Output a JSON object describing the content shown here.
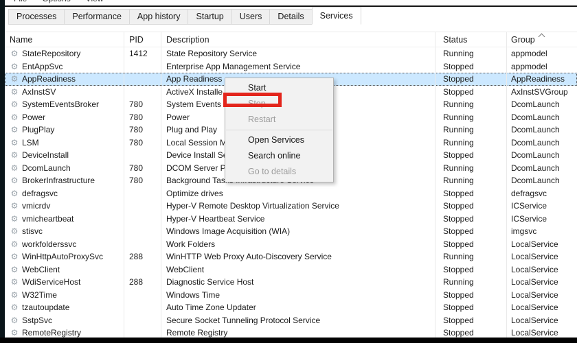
{
  "menubar": {
    "items": [
      "File",
      "Options",
      "View"
    ]
  },
  "tabs": {
    "items": [
      {
        "label": "Processes",
        "active": false
      },
      {
        "label": "Performance",
        "active": false
      },
      {
        "label": "App history",
        "active": false
      },
      {
        "label": "Startup",
        "active": false
      },
      {
        "label": "Users",
        "active": false
      },
      {
        "label": "Details",
        "active": false
      },
      {
        "label": "Services",
        "active": true
      }
    ]
  },
  "table": {
    "columns": [
      {
        "key": "name",
        "label": "Name"
      },
      {
        "key": "pid",
        "label": "PID"
      },
      {
        "key": "description",
        "label": "Description"
      },
      {
        "key": "status",
        "label": "Status"
      },
      {
        "key": "group",
        "label": "Group"
      }
    ],
    "sorted_column": "Group",
    "sort_direction": "ascending",
    "rows": [
      {
        "name": "StateRepository",
        "pid": "1412",
        "description": "State Repository Service",
        "status": "Running",
        "group": "appmodel",
        "selected": false
      },
      {
        "name": "EntAppSvc",
        "pid": "",
        "description": "Enterprise App Management Service",
        "status": "Stopped",
        "group": "appmodel",
        "selected": false
      },
      {
        "name": "AppReadiness",
        "pid": "",
        "description": "App Readiness",
        "status": "Stopped",
        "group": "AppReadiness",
        "selected": true
      },
      {
        "name": "AxInstSV",
        "pid": "",
        "description": "ActiveX Installe",
        "status": "Stopped",
        "group": "AxInstSVGroup",
        "selected": false
      },
      {
        "name": "SystemEventsBroker",
        "pid": "780",
        "description": "System Events B",
        "status": "Running",
        "group": "DcomLaunch",
        "selected": false
      },
      {
        "name": "Power",
        "pid": "780",
        "description": "Power",
        "status": "Running",
        "group": "DcomLaunch",
        "selected": false
      },
      {
        "name": "PlugPlay",
        "pid": "780",
        "description": "Plug and Play",
        "status": "Running",
        "group": "DcomLaunch",
        "selected": false
      },
      {
        "name": "LSM",
        "pid": "780",
        "description": "Local Session M",
        "status": "Running",
        "group": "DcomLaunch",
        "selected": false
      },
      {
        "name": "DeviceInstall",
        "pid": "",
        "description": "Device Install Se",
        "status": "Stopped",
        "group": "DcomLaunch",
        "selected": false
      },
      {
        "name": "DcomLaunch",
        "pid": "780",
        "description": "DCOM Server Pr",
        "status": "Running",
        "group": "DcomLaunch",
        "selected": false
      },
      {
        "name": "BrokerInfrastructure",
        "pid": "780",
        "description": "Background Tasks Infrastructure Service",
        "status": "Running",
        "group": "DcomLaunch",
        "selected": false
      },
      {
        "name": "defragsvc",
        "pid": "",
        "description": "Optimize drives",
        "status": "Stopped",
        "group": "defragsvc",
        "selected": false
      },
      {
        "name": "vmicrdv",
        "pid": "",
        "description": "Hyper-V Remote Desktop Virtualization Service",
        "status": "Stopped",
        "group": "ICService",
        "selected": false
      },
      {
        "name": "vmicheartbeat",
        "pid": "",
        "description": "Hyper-V Heartbeat Service",
        "status": "Stopped",
        "group": "ICService",
        "selected": false
      },
      {
        "name": "stisvc",
        "pid": "",
        "description": "Windows Image Acquisition (WIA)",
        "status": "Stopped",
        "group": "imgsvc",
        "selected": false
      },
      {
        "name": "workfolderssvc",
        "pid": "",
        "description": "Work Folders",
        "status": "Stopped",
        "group": "LocalService",
        "selected": false
      },
      {
        "name": "WinHttpAutoProxySvc",
        "pid": "288",
        "description": "WinHTTP Web Proxy Auto-Discovery Service",
        "status": "Running",
        "group": "LocalService",
        "selected": false
      },
      {
        "name": "WebClient",
        "pid": "",
        "description": "WebClient",
        "status": "Stopped",
        "group": "LocalService",
        "selected": false
      },
      {
        "name": "WdiServiceHost",
        "pid": "288",
        "description": "Diagnostic Service Host",
        "status": "Running",
        "group": "LocalService",
        "selected": false
      },
      {
        "name": "W32Time",
        "pid": "",
        "description": "Windows Time",
        "status": "Stopped",
        "group": "LocalService",
        "selected": false
      },
      {
        "name": "tzautoupdate",
        "pid": "",
        "description": "Auto Time Zone Updater",
        "status": "Stopped",
        "group": "LocalService",
        "selected": false
      },
      {
        "name": "SstpSvc",
        "pid": "",
        "description": "Secure Socket Tunneling Protocol Service",
        "status": "Stopped",
        "group": "LocalService",
        "selected": false
      },
      {
        "name": "RemoteRegistry",
        "pid": "",
        "description": "Remote Registry",
        "status": "Stopped",
        "group": "LocalService",
        "selected": false
      }
    ]
  },
  "context_menu": {
    "items": [
      {
        "label": "Start",
        "enabled": true
      },
      {
        "label": "Stop",
        "enabled": false,
        "annotated": true
      },
      {
        "label": "Restart",
        "enabled": false
      },
      {
        "type": "separator"
      },
      {
        "label": "Open Services",
        "enabled": true
      },
      {
        "label": "Search online",
        "enabled": true
      },
      {
        "label": "Go to details",
        "enabled": false
      }
    ]
  },
  "annotation": {
    "shape": "rectangle",
    "target": "Stop",
    "color": "#e3251c"
  },
  "icons": {
    "service_icon": "gear-icon",
    "sort_indicator": "chevron-up-icon"
  },
  "colors": {
    "selection_bg": "#cce8ff",
    "menu_bg": "#f2f2f2",
    "disabled_text": "#9b9b9b",
    "annotation_red": "#e3251c"
  }
}
